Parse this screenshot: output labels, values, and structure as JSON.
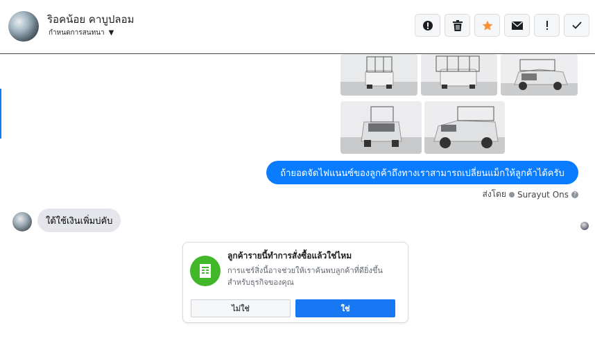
{
  "header": {
    "contact_name": "ริอคน้อย คาบูปลอม",
    "subtitle": "กำหนดการสนทนา"
  },
  "toolbar": {
    "buttons": [
      {
        "icon": "alert-circle-icon"
      },
      {
        "icon": "trash-icon"
      },
      {
        "icon": "star-icon",
        "color": "#f7923b"
      },
      {
        "icon": "envelope-icon"
      },
      {
        "icon": "exclamation-icon"
      },
      {
        "icon": "checkmark-icon"
      }
    ]
  },
  "conversation": {
    "photos": [
      {
        "alt": "truck-rear-cage"
      },
      {
        "alt": "truck-rear-cage-angle"
      },
      {
        "alt": "truck-front-side"
      },
      {
        "alt": "truck-front-cage"
      },
      {
        "alt": "truck-side-cage"
      }
    ],
    "outgoing_message": "ถ้ายอดจัดไฟแนนซ์ของลูกค้าถึงทางเราสามารถเปลี่ยนแม็กให้ลูกค้าได้ครับ",
    "sent_by_label": "ส่งโดย",
    "sent_by_name": "Surayut Ons",
    "incoming_message": "ใด้ใช้เงินเพิ่มบ่คับ"
  },
  "prompt_card": {
    "title": "ลูกค้ารายนี้ทำการสั่งซื้อแล้วใช่ไหม",
    "body": "การแชร์สิ่งนี้อาจช่วยให้เราค้นพบลูกค้าที่ดียิ่งขึ้นสำหรับธุรกิจของคุณ",
    "no_label": "ไม่ใช่",
    "yes_label": "ใช่",
    "accent": "#42b72a",
    "primary": "#1877f2"
  }
}
